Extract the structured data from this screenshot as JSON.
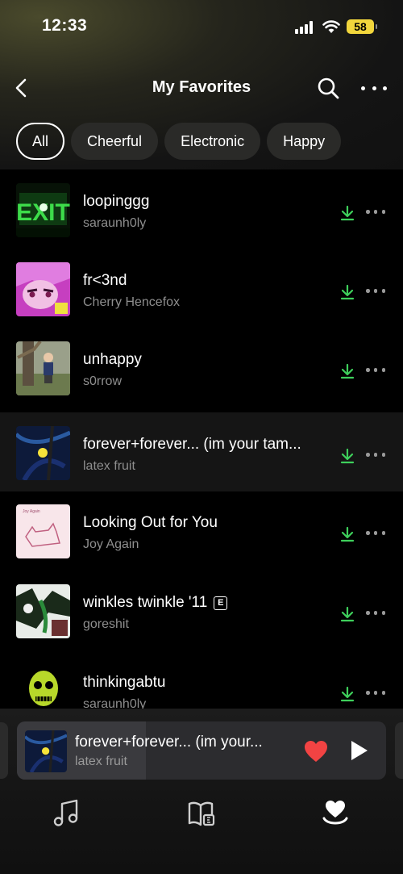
{
  "status_bar": {
    "time": "12:33",
    "battery": "58"
  },
  "header": {
    "title": "My Favorites",
    "back_icon": "chevron-left-icon",
    "search_icon": "search-icon",
    "more_icon": "ellipsis-icon"
  },
  "filters": [
    {
      "label": "All",
      "active": true
    },
    {
      "label": "Cheerful",
      "active": false
    },
    {
      "label": "Electronic",
      "active": false
    },
    {
      "label": "Happy",
      "active": false
    }
  ],
  "tracks": [
    {
      "title": "loopinggg",
      "artist": "saraunh0ly",
      "explicit": false,
      "downloaded": true
    },
    {
      "title": "fr<3nd",
      "artist": "Cherry Hencefox",
      "explicit": false,
      "downloaded": true
    },
    {
      "title": "unhappy",
      "artist": "s0rrow",
      "explicit": false,
      "downloaded": true
    },
    {
      "title": "forever+forever... (im your tam...",
      "artist": "latex fruit",
      "explicit": false,
      "downloaded": true,
      "playing": true
    },
    {
      "title": "Looking Out for You",
      "artist": "Joy Again",
      "explicit": false,
      "downloaded": true
    },
    {
      "title": "winkles twinkle '11",
      "artist": "goreshit",
      "explicit": true,
      "downloaded": true
    },
    {
      "title": "thinkingabtu",
      "artist": "saraunh0ly",
      "explicit": false,
      "downloaded": true
    }
  ],
  "explicit_badge": "E",
  "mini_player": {
    "title": "forever+forever... (im your...",
    "artist": "latex fruit",
    "liked": true,
    "progress": 0.35
  },
  "tabs": [
    {
      "icon": "music-note-icon",
      "active": false
    },
    {
      "icon": "library-book-icon",
      "active": false
    },
    {
      "icon": "favorites-heart-icon",
      "active": true
    }
  ],
  "colors": {
    "accent_download": "#3ecf5b",
    "like": "#f24343",
    "battery": "#f2d63c"
  }
}
